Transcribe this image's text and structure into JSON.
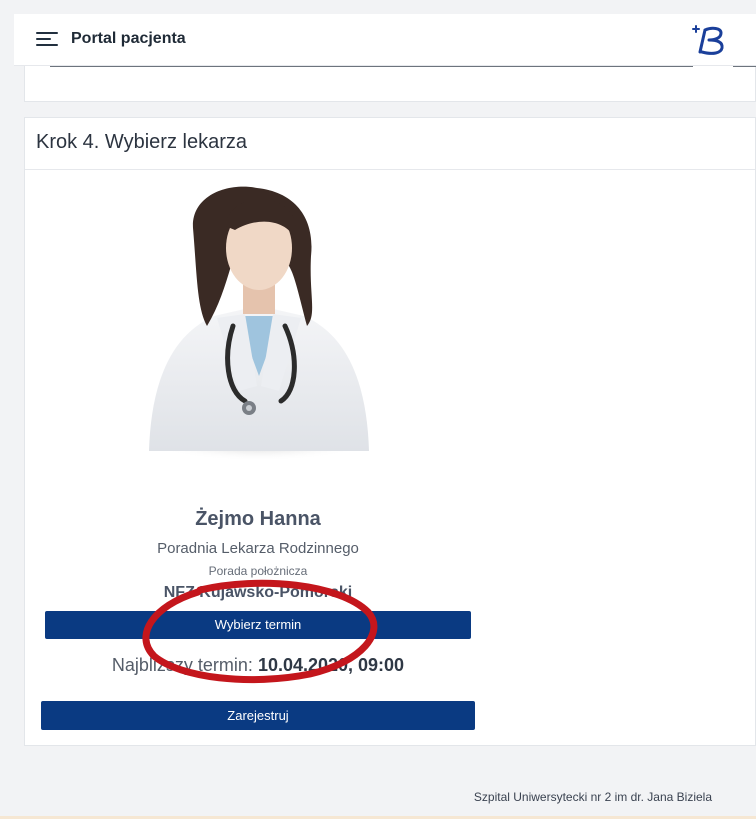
{
  "header": {
    "title": "Portal pacjenta",
    "menu_icon": "hamburger-menu-icon",
    "logo_icon": "brand-b-logo-icon"
  },
  "step": {
    "title": "Krok 4. Wybierz lekarza"
  },
  "doctor": {
    "avatar_icon": "female-doctor-avatar",
    "name": "Żejmo Hanna",
    "clinic": "Poradnia Lekarza Rodzinnego",
    "service": "Porada położnicza",
    "nfz": "NFZ Kujawsko-Pomorski",
    "choose_term_label": "Wybierz termin",
    "nearest_label": "Najbliższy termin: ",
    "nearest_value": "10.04.2020, 09:00",
    "register_label": "Zarejestruj"
  },
  "footer": {
    "hospital": "Szpital Uniwersytecki nr 2 im dr. Jana Biziela"
  },
  "colors": {
    "primary_button": "#0a3a82",
    "annotation_red": "#c4161c",
    "logo_blue": "#1a3f9a",
    "footer_accent": "#f6e7d3"
  }
}
